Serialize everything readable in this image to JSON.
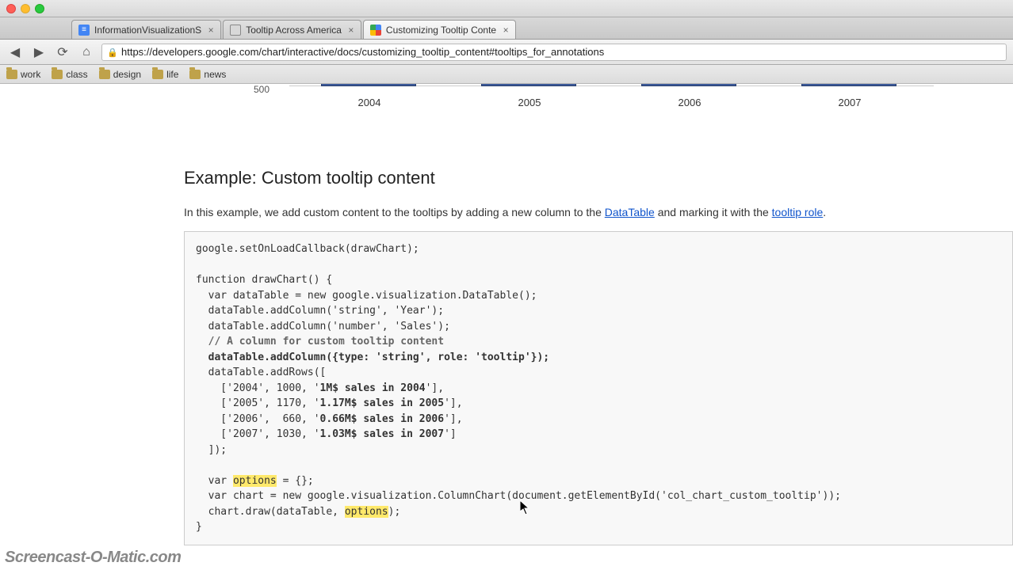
{
  "tabs": [
    {
      "title": "InformationVisualizationS",
      "fav": "doc"
    },
    {
      "title": "Tooltip Across America",
      "fav": "pin"
    },
    {
      "title": "Customizing Tooltip Conte",
      "fav": "goog"
    }
  ],
  "url": "https://developers.google.com/chart/interactive/docs/customizing_tooltip_content#tooltips_for_annotations",
  "bookmarks": [
    "work",
    "class",
    "design",
    "life",
    "news"
  ],
  "axis_tick": "500",
  "years": [
    "2004",
    "2005",
    "2006",
    "2007"
  ],
  "heading": "Example: Custom tooltip content",
  "intro": {
    "pre": "In this example, we add custom content to the tooltips by adding a new column to the ",
    "link1": "DataTable",
    "mid": " and marking it with the ",
    "link2": "tooltip role",
    "post": "."
  },
  "code": {
    "l1": "google.setOnLoadCallback(drawChart);",
    "l2": "function drawChart() {",
    "l3": "  var dataTable = new google.visualization.DataTable();",
    "l4": "  dataTable.addColumn('string', 'Year');",
    "l5": "  dataTable.addColumn('number', 'Sales');",
    "l6": "  // A column for custom tooltip content",
    "l7": "  dataTable.addColumn({type: 'string', role: 'tooltip'});",
    "l8": "  dataTable.addRows([",
    "l9a": "    ['2004', 1000, '",
    "l9b": "1M$ sales in 2004",
    "l9c": "'],",
    "l10a": "    ['2005', 1170, '",
    "l10b": "1.17M$ sales in 2005",
    "l10c": "'],",
    "l11a": "    ['2006',  660, '",
    "l11b": "0.66M$ sales in 2006",
    "l11c": "'],",
    "l12a": "    ['2007', 1030, '",
    "l12b": "1.03M$ sales in 2007",
    "l12c": "']",
    "l13": "  ]);",
    "l14a": "  var ",
    "l14b": "options",
    "l14c": " = {};",
    "l15": "  var chart = new google.visualization.ColumnChart(document.getElementById('col_chart_custom_tooltip'));",
    "l16a": "  chart.draw(dataTable, ",
    "l16b": "options",
    "l16c": ");",
    "l17": "}"
  },
  "chart_data": {
    "type": "bar",
    "categories": [
      "2004",
      "2005",
      "2006",
      "2007"
    ],
    "series": [
      {
        "name": "Sales",
        "values": [
          1000,
          1170,
          660,
          1030
        ]
      }
    ],
    "tooltips": [
      "1M$ sales in 2004",
      "1.17M$ sales in 2005",
      "0.66M$ sales in 2006",
      "1.03M$ sales in 2007"
    ],
    "ylim_visible_tick": 500,
    "note": "Only bottom axis fragment of a column chart is visible in the screenshot"
  },
  "watermark": "Screencast-O-Matic.com"
}
